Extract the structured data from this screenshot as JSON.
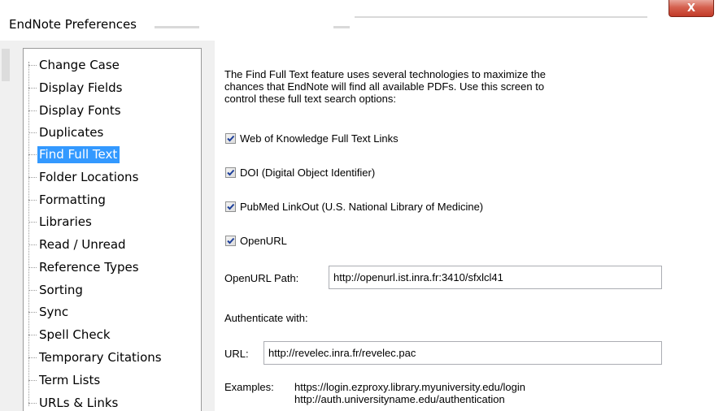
{
  "window": {
    "title": "EndNote Preferences",
    "close_glyph": "X"
  },
  "sidebar": {
    "selected": "Find Full Text",
    "items": [
      {
        "label": "Change Case"
      },
      {
        "label": "Display Fields"
      },
      {
        "label": "Display Fonts"
      },
      {
        "label": "Duplicates"
      },
      {
        "label": "Find Full Text"
      },
      {
        "label": "Folder Locations"
      },
      {
        "label": "Formatting"
      },
      {
        "label": "Libraries"
      },
      {
        "label": "Read / Unread"
      },
      {
        "label": "Reference Types"
      },
      {
        "label": "Sorting"
      },
      {
        "label": "Sync"
      },
      {
        "label": "Spell Check"
      },
      {
        "label": "Temporary Citations"
      },
      {
        "label": "Term Lists"
      },
      {
        "label": "URLs & Links"
      }
    ]
  },
  "panel": {
    "description": [
      "The Find Full Text feature uses several technologies to maximize the",
      "chances that EndNote will find all available PDFs. Use this screen to",
      "control these full text search options:"
    ],
    "options": [
      {
        "label": "Web of Knowledge Full Text Links",
        "checked": true
      },
      {
        "label": "DOI (Digital Object Identifier)",
        "checked": true
      },
      {
        "label": "PubMed LinkOut (U.S. National Library of Medicine)",
        "checked": true
      },
      {
        "label": "OpenURL",
        "checked": true
      }
    ],
    "openurl_path_label": "OpenURL Path:",
    "openurl_path_value": "http://openurl.ist.inra.fr:3410/sfxlcl41",
    "authenticate_label": "Authenticate with:",
    "url_label": "URL:",
    "url_value": "http://revelec.inra.fr/revelec.pac",
    "examples_label": "Examples:",
    "examples": [
      "https://login.ezproxy.library.myuniversity.edu/login",
      "http://auth.universityname.edu/authentication"
    ]
  },
  "colors": {
    "selection": "#3399ff",
    "close_button": "#c23a28",
    "check_mark": "#1d3f9a"
  }
}
